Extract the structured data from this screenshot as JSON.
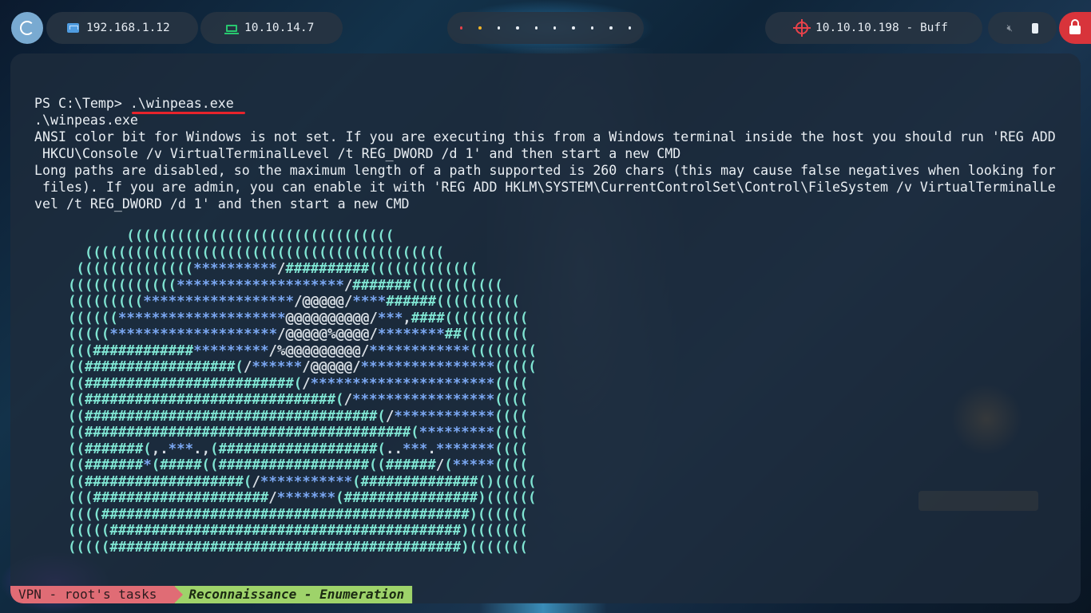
{
  "topbar": {
    "local_ip": "192.168.1.12",
    "vpn_ip": "10.10.14.7",
    "target": "10.10.10.198 - Buff",
    "workspace_dot_colors": [
      "#e8424a",
      "#f0b429",
      "#e8eef4",
      "#e8eef4",
      "#e8eef4",
      "#e8eef4",
      "#e8eef4",
      "#e8eef4",
      "#e8eef4",
      "#e8eef4"
    ]
  },
  "terminal": {
    "lines": [
      "PS C:\\Temp> .\\winpeas.exe",
      ".\\winpeas.exe",
      "ANSI color bit for Windows is not set. If you are executing this from a Windows terminal inside the host you should run 'REG ADD",
      " HKCU\\Console /v VirtualTerminalLevel /t REG_DWORD /d 1' and then start a new CMD",
      "Long paths are disabled, so the maximum length of a path supported is 260 chars (this may cause false negatives when looking for",
      " files). If you are admin, you can enable it with 'REG ADD HKLM\\SYSTEM\\CurrentControlSet\\Control\\FileSystem /v VirtualTerminalLe",
      "vel /t REG_DWORD /d 1' and then start a new CMD"
    ],
    "banner": [
      "       ((((((((((((((((((((((((((((((((",
      "  (((((((((((((((((((((((((((((((((((((((((((",
      " ((((((((((((((**********/##########(((((((((((((",
      "(((((((((((((********************/#######(((((((((((",
      "(((((((((******************/@@@@@/****######((((((((((",
      "((((((********************@@@@@@@@@@/***,####((((((((((",
      "(((((********************/@@@@@%@@@@/********##((((((((",
      "(((############*********/%@@@@@@@@@/************((((((((",
      "((##################(/******/@@@@@/****************(((((",
      "((#########################(/**********************((((",
      "((##############################(/*****************((((",
      "((###################################(/************((((",
      "((#######################################(*********((((",
      "((#######(,.***.,(###################(..***.*******((((",
      "((#######*(#####((##################((######/(*****((((",
      "((###################(/***********(##############()(((((",
      "(((#####################/*******(################)((((((",
      "((((############################################)((((((",
      "(((((##########################################)(((((((",
      "(((((##########################################)((((((("
    ]
  },
  "statusbar": {
    "session": "VPN - root's tasks",
    "window": "Reconnaissance - Enumeration"
  }
}
